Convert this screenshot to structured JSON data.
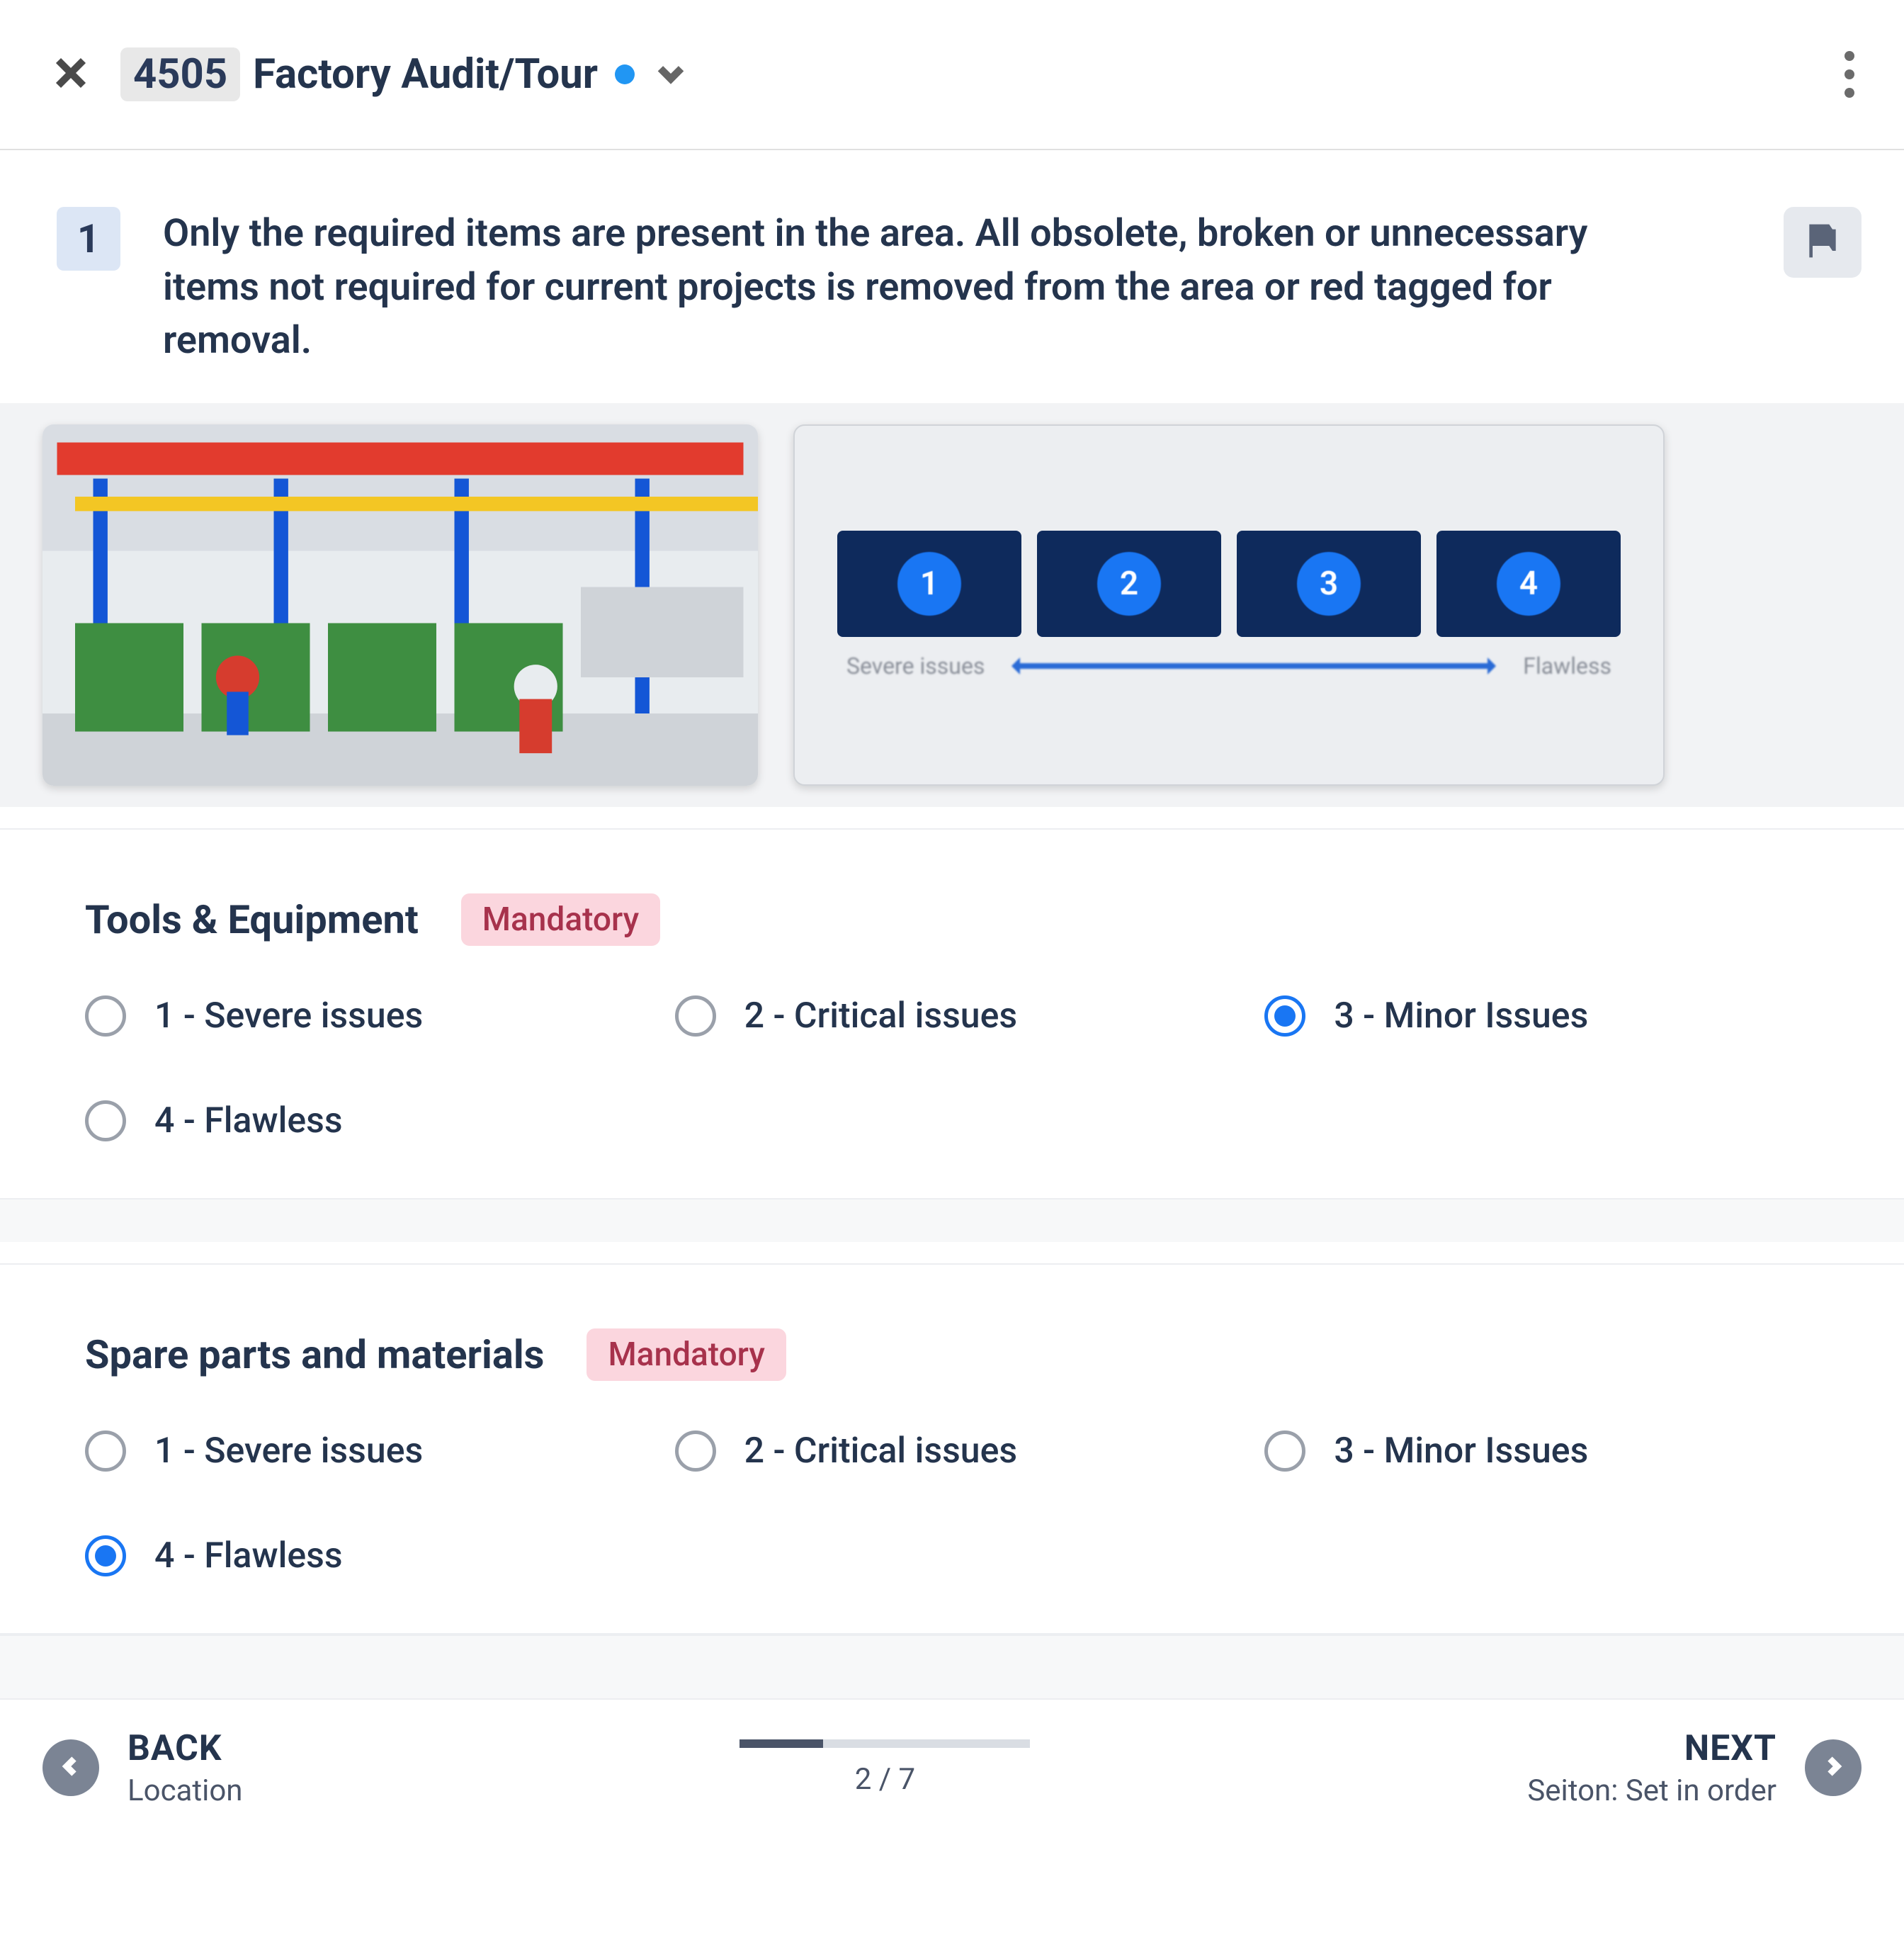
{
  "header": {
    "id_badge": "4505",
    "title": "Factory Audit/Tour"
  },
  "question": {
    "number": "1",
    "text": "Only the required items are present in the area. All obsolete, broken or unnecessary items not required for current projects is removed from the area or red tagged for removal."
  },
  "rating_scale": {
    "tiles": [
      "1",
      "2",
      "3",
      "4"
    ],
    "left_label": "Severe issues",
    "right_label": "Flawless"
  },
  "sections": [
    {
      "title": "Tools & Equipment",
      "badge": "Mandatory",
      "options": [
        "1 - Severe issues",
        "2 - Critical issues",
        "3 - Minor Issues",
        "4 - Flawless"
      ],
      "selected": 2
    },
    {
      "title": "Spare parts and materials",
      "badge": "Mandatory",
      "options": [
        "1 - Severe issues",
        "2 - Critical issues",
        "3 - Minor Issues",
        "4 - Flawless"
      ],
      "selected": 3
    }
  ],
  "footer": {
    "back_label": "BACK",
    "back_sub": "Location",
    "next_label": "NEXT",
    "next_sub": "Seiton: Set in order",
    "page_current": 2,
    "page_total": 7,
    "page_text": "2 / 7",
    "progress_pct": 28.57
  }
}
